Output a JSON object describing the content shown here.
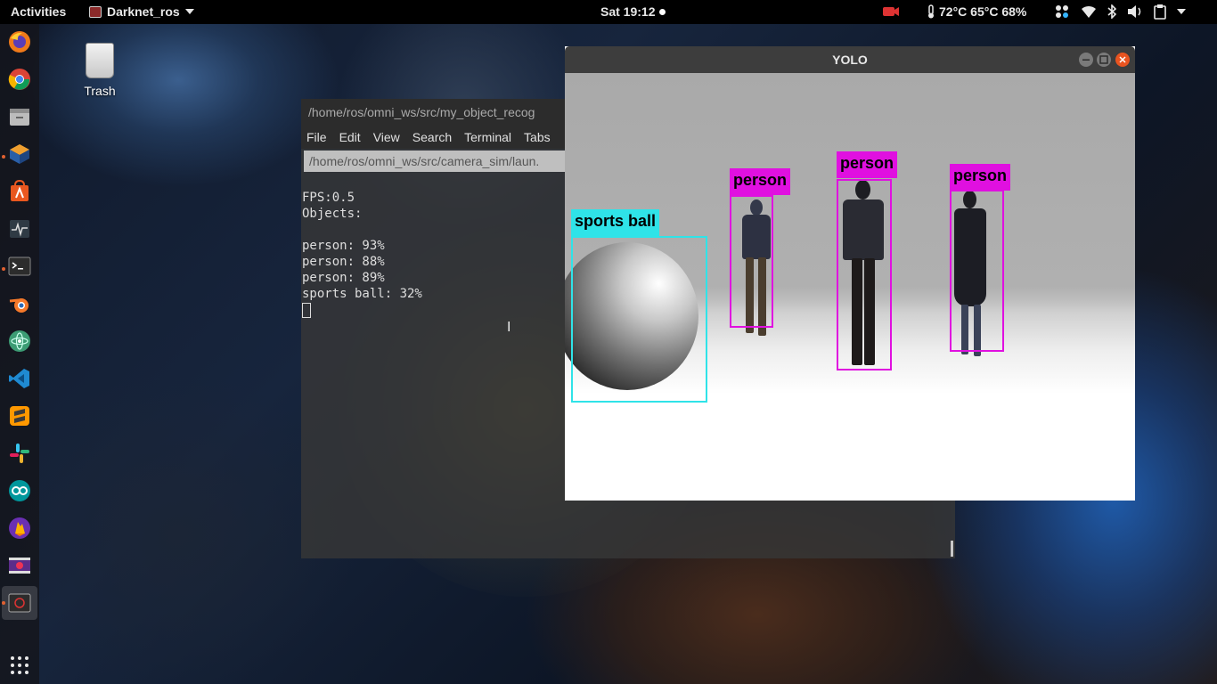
{
  "topbar": {
    "activities": "Activities",
    "app_name": "Darknet_ros",
    "clock": "Sat 19:12",
    "sensors": "72°C 65°C 68%"
  },
  "desktop": {
    "trash_label": "Trash"
  },
  "dock": {
    "items": [
      "firefox-icon",
      "chrome-icon",
      "files-icon",
      "virtualbox-icon",
      "software-center-icon",
      "system-monitor-icon",
      "terminal-icon",
      "blender-icon",
      "atom-icon",
      "vscode-icon",
      "sublime-icon",
      "slack-icon",
      "arduino-icon",
      "firebase-icon",
      "video-icon",
      "yolo-window-icon",
      "app-grid-icon"
    ]
  },
  "terminal": {
    "title": "/home/ros/omni_ws/src/my_object_recog",
    "menu": [
      "File",
      "Edit",
      "View",
      "Search",
      "Terminal",
      "Tabs"
    ],
    "tab_title": "/home/ros/omni_ws/src/camera_sim/laun.",
    "lines": {
      "fps": "FPS:0.5",
      "objects": "Objects:",
      "blank": "",
      "det1": "person: 93%",
      "det2": "person: 88%",
      "det3": "person: 89%",
      "det4": "sports ball: 32%"
    }
  },
  "yolo_window": {
    "title": "YOLO",
    "detections": [
      {
        "label": "sports ball",
        "color": "#2fe3e8"
      },
      {
        "label": "person",
        "color": "#e010e0"
      },
      {
        "label": "person",
        "color": "#e010e0"
      },
      {
        "label": "person",
        "color": "#e010e0"
      }
    ]
  },
  "colors": {
    "person_box": "#e010e0",
    "ball_box": "#2fe3e8",
    "dock_bg": "#141419",
    "topbar_bg": "#000000"
  }
}
